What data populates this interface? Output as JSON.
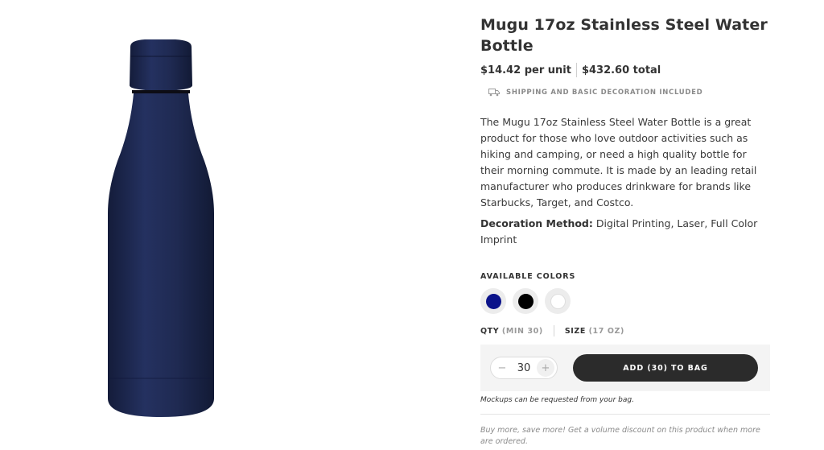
{
  "product": {
    "title": "Mugu 17oz Stainless Steel Water Bottle",
    "price_per_unit": "$14.42 per unit",
    "price_total": "$432.60 total",
    "shipping_note": "SHIPPING AND BASIC DECORATION INCLUDED",
    "description": "The Mugu 17oz Stainless Steel Water Bottle is a great product for those who love outdoor activities such as hiking and camping, or need a high quality bottle for their morning commute. It is made by an leading retail manufacturer who produces drinkware for brands like Starbucks, Target, and Costco.",
    "decoration_label": "Decoration Method:",
    "decoration_value": " Digital Printing, Laser, Full Color Imprint",
    "image_color": "#1f2a4f"
  },
  "colors": {
    "label": "AVAILABLE COLORS",
    "options": [
      {
        "name": "navy",
        "hex": "#0b138a"
      },
      {
        "name": "black",
        "hex": "#000000"
      },
      {
        "name": "white",
        "hex": "#ffffff"
      }
    ]
  },
  "order": {
    "qty_label": "QTY",
    "qty_min": "(MIN 30)",
    "size_label": "SIZE",
    "size_value": "(17 OZ)",
    "quantity": "30",
    "minus": "−",
    "plus": "+",
    "add_button": "ADD (30) TO BAG",
    "mockups_note": "Mockups can be requested from your bag.",
    "volume_note": "Buy more, save more! Get a volume discount on this product when more are ordered."
  }
}
